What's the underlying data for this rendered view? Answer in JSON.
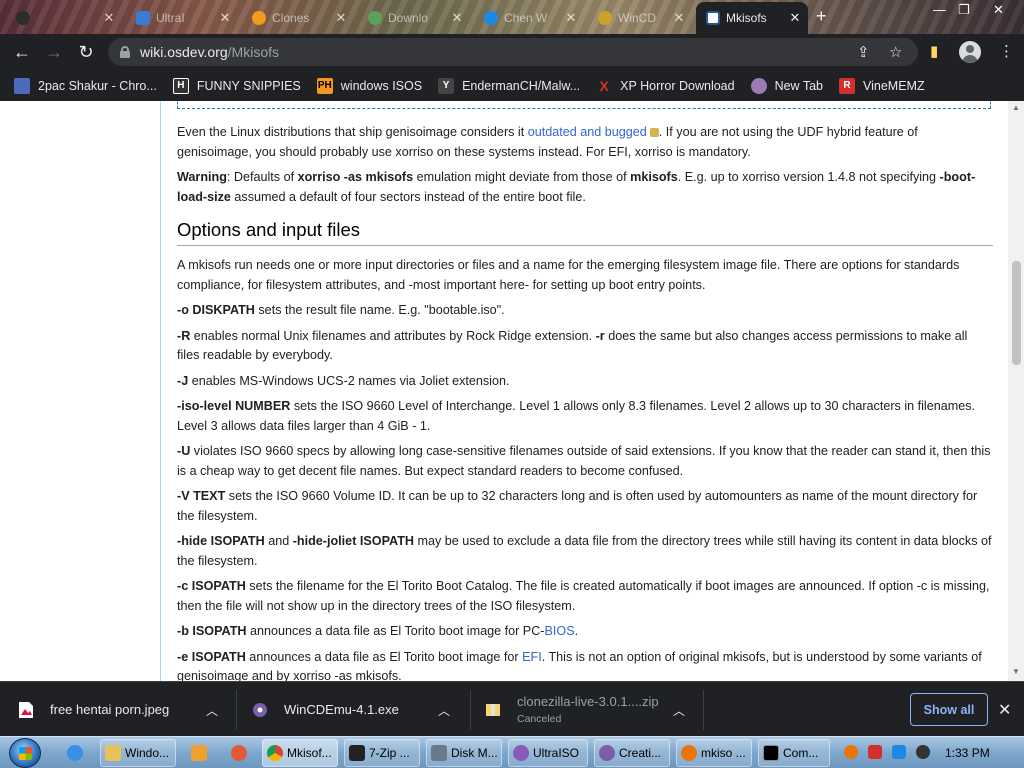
{
  "browser": {
    "tabs": [
      {
        "title": "",
        "close": "✕"
      },
      {
        "title": "UltraI",
        "close": "✕"
      },
      {
        "title": "Clones",
        "close": "✕"
      },
      {
        "title": "Downlo",
        "close": "✕"
      },
      {
        "title": "Chen W",
        "close": "✕"
      },
      {
        "title": "WinCD",
        "close": "✕"
      },
      {
        "title": "Mkisofs",
        "close": "✕"
      }
    ],
    "new_tab": "+",
    "window_controls": {
      "minimize": "—",
      "restore": "❐",
      "close": "✕"
    },
    "url_host": "wiki.osdev.org",
    "url_path": "/Mkisofs",
    "bookmarks": [
      {
        "label": "2pac Shakur - Chro...",
        "icon": "",
        "color": "#4b6bbf"
      },
      {
        "label": "FUNNY SNIPPIES",
        "icon": "H",
        "color": "#333333"
      },
      {
        "label": "windows ISOS",
        "icon": "PH",
        "color": "#f7971d"
      },
      {
        "label": "EndermanCH/Malw...",
        "icon": "Y",
        "color": "#444444"
      },
      {
        "label": "XP Horror Download",
        "icon": "X",
        "color": "#d93025"
      },
      {
        "label": "New Tab",
        "icon": "",
        "color": "#9e7ab4"
      },
      {
        "label": "VineMEMZ",
        "icon": "R",
        "color": "#d32f2f"
      }
    ]
  },
  "article": {
    "p1_a": "Even the Linux distributions that ship genisoimage considers it ",
    "p1_link": "outdated and bugged",
    "p1_b": ". If you are not using the UDF hybrid feature of genisoimage, you should probably use xorriso on these systems instead. For EFI, xorriso is mandatory.",
    "p2_warning": "Warning",
    "p2_a": ": Defaults of ",
    "p2_xorriso": "xorriso -as mkisofs",
    "p2_b": " emulation might deviate from those of ",
    "p2_mkisofs": "mkisofs",
    "p2_c": ". E.g. up to xorriso version 1.4.8 not specifying ",
    "p2_opt": "-boot-load-size",
    "p2_d": " assumed a default of four sectors instead of the entire boot file.",
    "heading": "Options and input files",
    "intro": "A mkisofs run needs one or more input directories or files and a name for the emerging filesystem image file. There are options for standards compliance, for filesystem attributes, and -most important here- for setting up boot entry points.",
    "o_opt": "-o DISKPATH",
    "o_text": " sets the result file name. E.g. \"bootable.iso\".",
    "R_opt": "-R",
    "R_a": " enables normal Unix filenames and attributes by Rock Ridge extension. ",
    "r_opt": "-r",
    "R_b": " does the same but also changes access permissions to make all files readable by everybody.",
    "J_opt": "-J",
    "J_text": " enables MS-Windows UCS-2 names via Joliet extension.",
    "iso_opt": "-iso-level NUMBER",
    "iso_text": " sets the ISO 9660 Level of Interchange. Level 1 allows only 8.3 filenames. Level 2 allows up to 30 characters in filenames. Level 3 allows data files larger than 4 GiB - 1.",
    "U_opt": "-U",
    "U_text": " violates ISO 9660 specs by allowing long case-sensitive filenames outside of said extensions. If you know that the reader can stand it, then this is a cheap way to get decent file names. But expect standard readers to become confused.",
    "V_opt": "-V TEXT",
    "V_text": " sets the ISO 9660 Volume ID. It can be up to 32 characters long and is often used by automounters as name of the mount directory for the filesystem.",
    "hide_opt": "-hide ISOPATH",
    "hide_and": " and ",
    "hidej_opt": "-hide-joliet ISOPATH",
    "hide_text": " may be used to exclude a data file from the directory trees while still having its content in data blocks of the filesystem.",
    "c_opt": "-c ISOPATH",
    "c_text": " sets the filename for the El Torito Boot Catalog. The file is created automatically if boot images are announced. If option -c is missing, then the file will not show up in the directory trees of the ISO filesystem.",
    "b_opt": "-b ISOPATH",
    "b_text": " announces a data file as El Torito boot image for PC-",
    "b_link": "BIOS",
    "b_end": ".",
    "e_opt": "-e ISOPATH",
    "e_text": " announces a data file as El Torito boot image for ",
    "e_link": "EFI",
    "e_text2": ". This is not an option of original mkisofs, but is understood by some variants of genisoimage and by xorriso -as mkisofs."
  },
  "downloads": {
    "items": [
      {
        "name": "free hentai porn.jpeg",
        "status": ""
      },
      {
        "name": "WinCDEmu-4.1.exe",
        "status": ""
      },
      {
        "name": "clonezilla-live-3.0.1....zip",
        "status": "Canceled"
      }
    ],
    "show_all": "Show all",
    "close": "✕"
  },
  "taskbar": {
    "buttons": [
      "Windo...",
      "Mkisof...",
      "7-Zip ...",
      "Disk M...",
      "UltraISO",
      "Creati...",
      "mkiso ...",
      "Com..."
    ],
    "clock": "1:33 PM"
  }
}
